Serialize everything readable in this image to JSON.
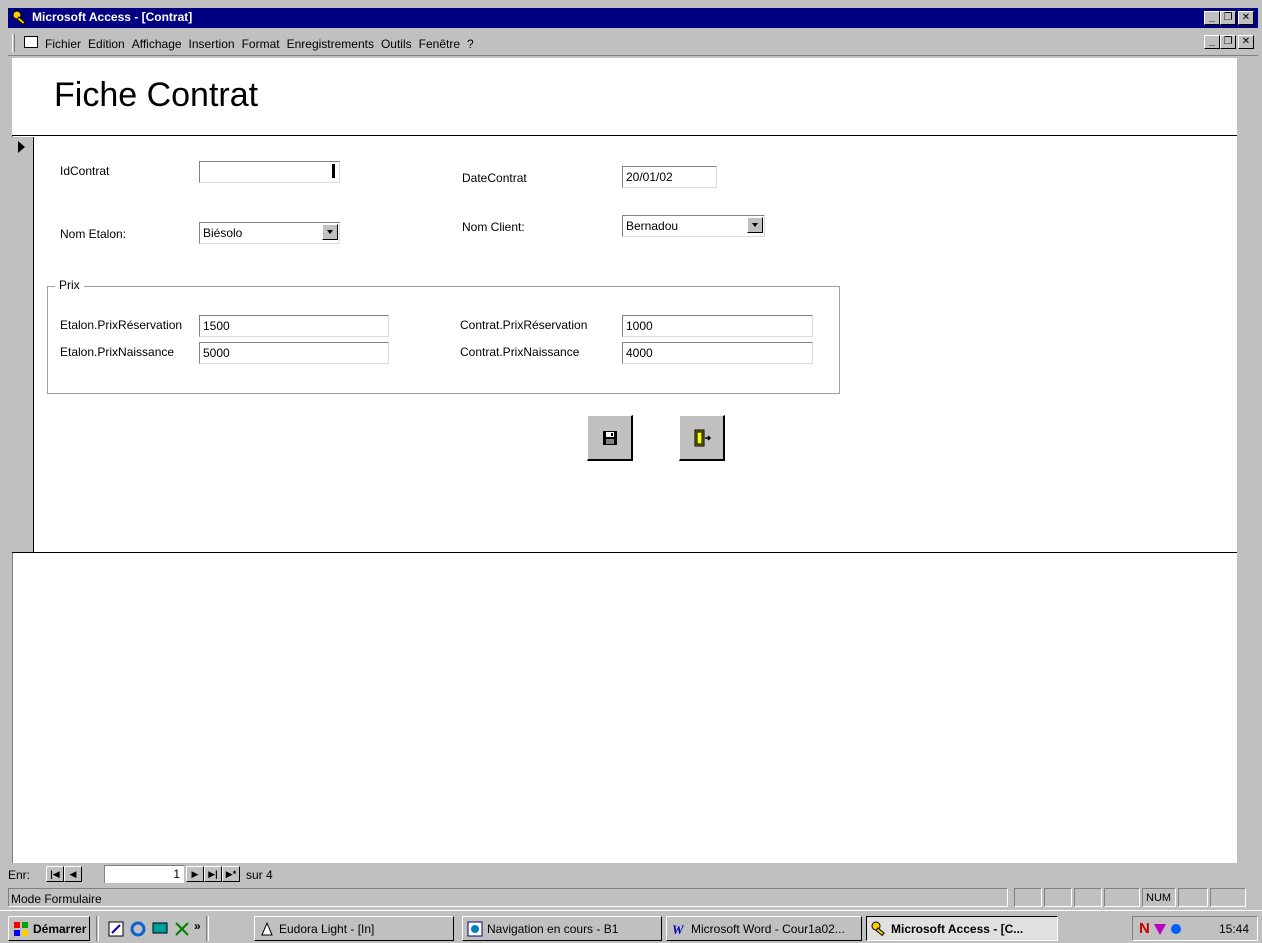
{
  "window": {
    "title": "Microsoft Access - [Contrat]"
  },
  "menu": {
    "items": [
      "Fichier",
      "Edition",
      "Affichage",
      "Insertion",
      "Format",
      "Enregistrements",
      "Outils",
      "Fenêtre",
      "?"
    ]
  },
  "form": {
    "title": "Fiche Contrat",
    "fields": {
      "id_contrat": {
        "label": "IdContrat",
        "value": ""
      },
      "date_contrat": {
        "label": "DateContrat",
        "value": "20/01/02"
      },
      "nom_etalon": {
        "label": "Nom Etalon:",
        "value": "Biésolo"
      },
      "nom_client": {
        "label": "Nom Client:",
        "value": "Bernadou"
      }
    },
    "prix_group": {
      "legend": "Prix",
      "etalon_prix_reservation": {
        "label": "Etalon.PrixRéservation",
        "value": "1500"
      },
      "etalon_prix_naissance": {
        "label": "Etalon.PrixNaissance",
        "value": "5000"
      },
      "contrat_prix_reservation": {
        "label": "Contrat.PrixRéservation",
        "value": "1000"
      },
      "contrat_prix_naissance": {
        "label": "Contrat.PrixNaissance",
        "value": "4000"
      }
    },
    "buttons": {
      "save_icon": "floppy-disk-icon",
      "exit_icon": "door-exit-icon"
    }
  },
  "navigation": {
    "label": "Enr:",
    "current": "1",
    "total_text": "sur 4"
  },
  "status": {
    "mode": "Mode Formulaire",
    "num": "NUM"
  },
  "taskbar": {
    "start": "Démarrer",
    "tasks": [
      "Eudora Light - [In]",
      "Navigation en cours - B1",
      "Microsoft Word - Cour1a02...",
      "Microsoft Access - [C..."
    ],
    "clock": "15:44"
  },
  "colors": {
    "titlebar": "#000080",
    "chrome": "#c0c0c0"
  }
}
